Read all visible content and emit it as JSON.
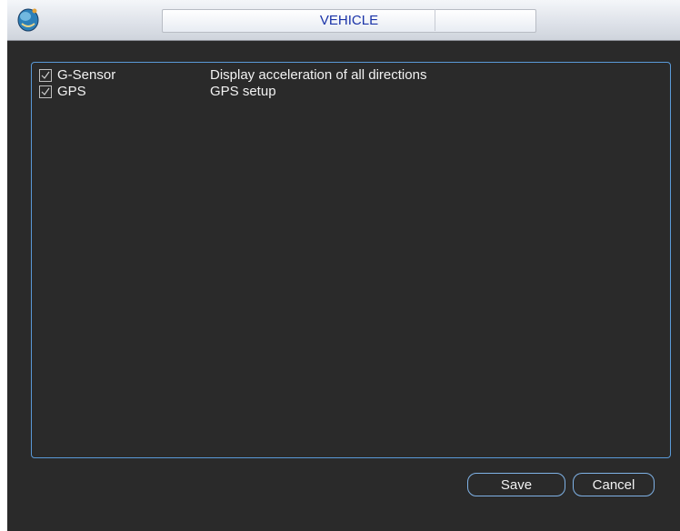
{
  "window": {
    "title": "VEHICLE"
  },
  "items": [
    {
      "label": "G-Sensor",
      "description": "Display acceleration of all directions",
      "checked": true
    },
    {
      "label": "GPS",
      "description": "GPS  setup",
      "checked": true
    }
  ],
  "buttons": {
    "save_label": "Save",
    "cancel_label": "Cancel"
  },
  "icons": {
    "logo": "globe-logo-icon",
    "check": "checkmark-icon"
  },
  "colors": {
    "background": "#2a2a2a",
    "title_text": "#1a33a8",
    "panel_border": "#5a9ad8",
    "text": "#f2f2f2"
  }
}
